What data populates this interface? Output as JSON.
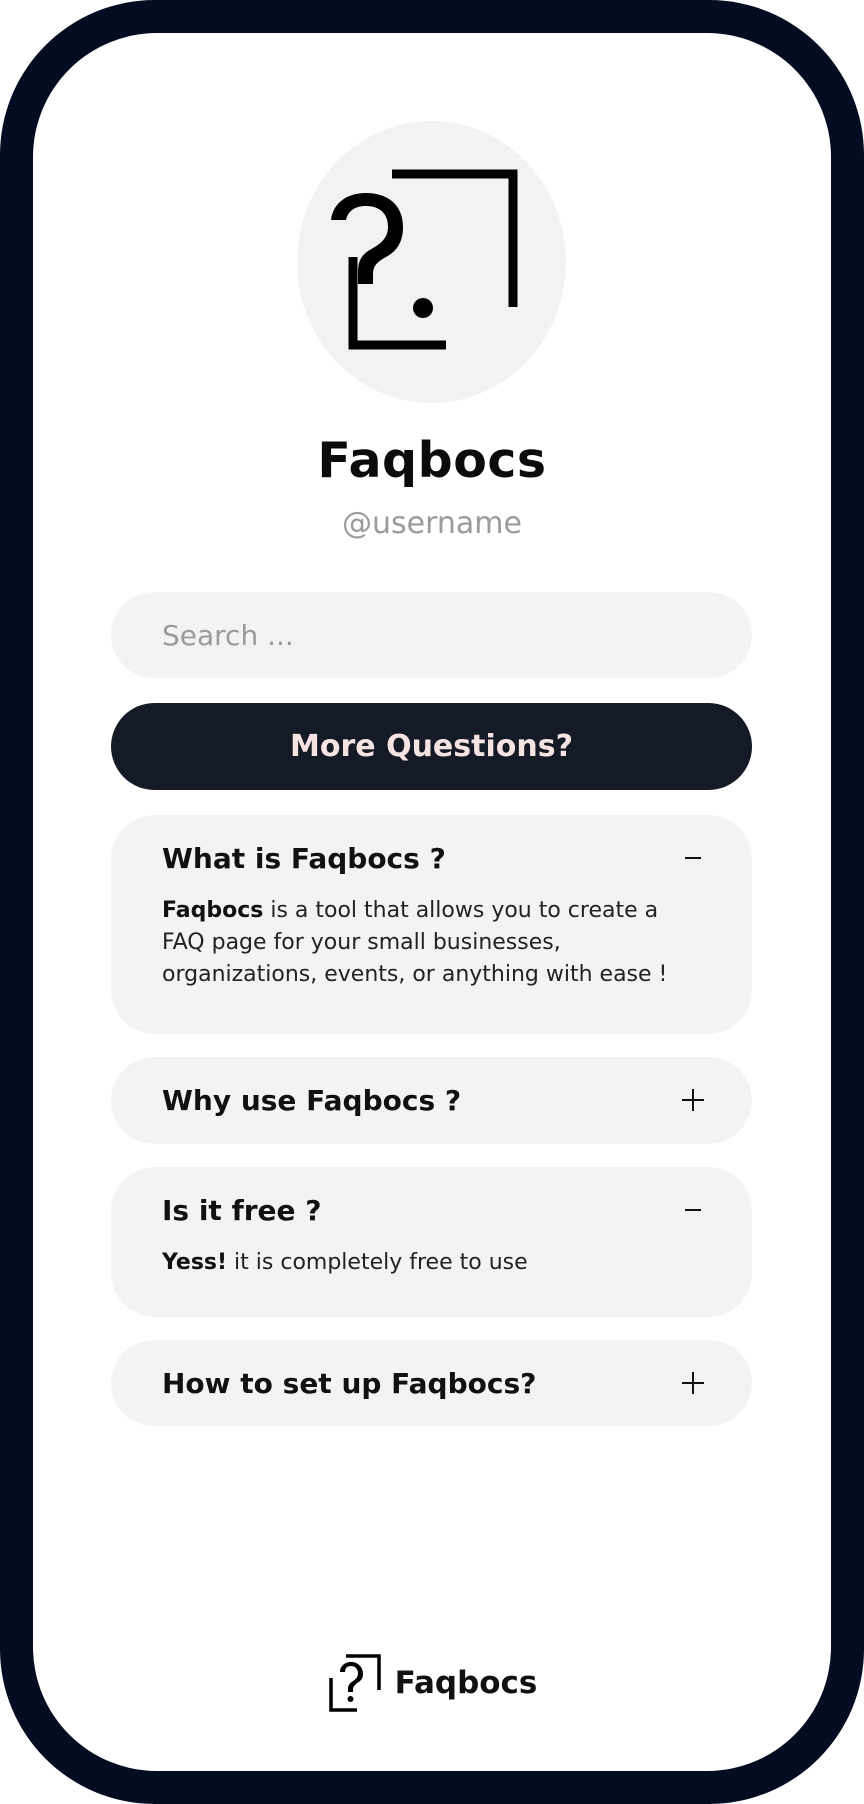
{
  "profile": {
    "logo_icon": "question-frame-icon",
    "title": "Faqbocs",
    "username": "@username"
  },
  "search": {
    "placeholder": "Search ..."
  },
  "more_button": {
    "label": "More Questions?"
  },
  "faqs": [
    {
      "question": "What is Faqbocs ?",
      "expanded": true,
      "answer_bold": "Faqbocs",
      "answer_rest": " is a tool that allows you to create a FAQ page for your small businesses, organizations, events, or anything with ease !"
    },
    {
      "question": "Why use Faqbocs ?",
      "expanded": false
    },
    {
      "question": "Is it free ?",
      "expanded": true,
      "answer_bold": "Yess!",
      "answer_rest": " it is completely free to use"
    },
    {
      "question": "How to set up Faqbocs?",
      "expanded": false
    }
  ],
  "footer": {
    "logo_icon": "question-frame-icon",
    "brand": "Faqbocs"
  },
  "colors": {
    "frame": "#030c21",
    "button_bg": "#141a26",
    "button_text": "#f8e3e3",
    "card_bg": "#f2f3f5"
  }
}
